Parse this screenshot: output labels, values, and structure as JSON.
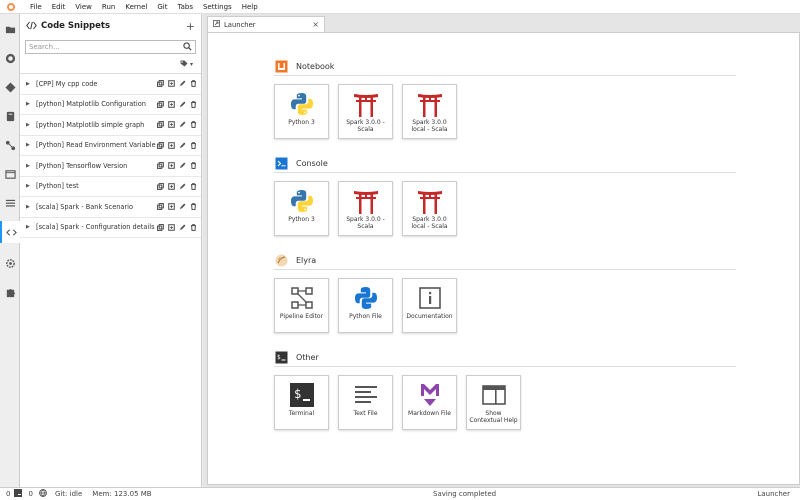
{
  "menubar": {
    "items": [
      "File",
      "Edit",
      "View",
      "Run",
      "Kernel",
      "Git",
      "Tabs",
      "Settings",
      "Help"
    ]
  },
  "sidebar": {
    "title": "Code Snippets",
    "add_label": "+",
    "search_placeholder": "Search...",
    "tag_filter_label": "▾",
    "snippets": [
      "[CPP] My cpp code",
      "[python] Matplotlib Configuration",
      "[python] Matplotlib simple graph",
      "[Python] Read Environment Variable",
      "[Python] Tensorflow Version",
      "[Python] test",
      "[scala] Spark - Bank Scenario",
      "[scala] Spark - Configuration details"
    ]
  },
  "tabs": [
    {
      "label": "Launcher",
      "close": "×"
    }
  ],
  "launcher": {
    "sections": [
      {
        "title": "Notebook",
        "cards": [
          "Python 3",
          "Spark 3.0.0 - Scala",
          "Spark 3.0.0 local - Scala"
        ]
      },
      {
        "title": "Console",
        "cards": [
          "Python 3",
          "Spark 3.0.0 - Scala",
          "Spark 3.0.0 local - Scala"
        ]
      },
      {
        "title": "Elyra",
        "cards": [
          "Pipeline Editor",
          "Python File",
          "Documentation"
        ]
      },
      {
        "title": "Other",
        "cards": [
          "Terminal",
          "Text File",
          "Markdown File",
          "Show Contextual Help"
        ]
      }
    ]
  },
  "statusbar": {
    "kernels": "0",
    "terminals": "0",
    "git": "Git: idle",
    "mem": "Mem: 123.05 MB",
    "status": "Saving completed",
    "activity": "Launcher"
  },
  "colors": {
    "notebook_accent": "#f37726",
    "console_accent": "#1976d2",
    "torii_red": "#c62828",
    "markdown_purple": "#8e44ad",
    "active_tab_border": "#2196f3"
  }
}
